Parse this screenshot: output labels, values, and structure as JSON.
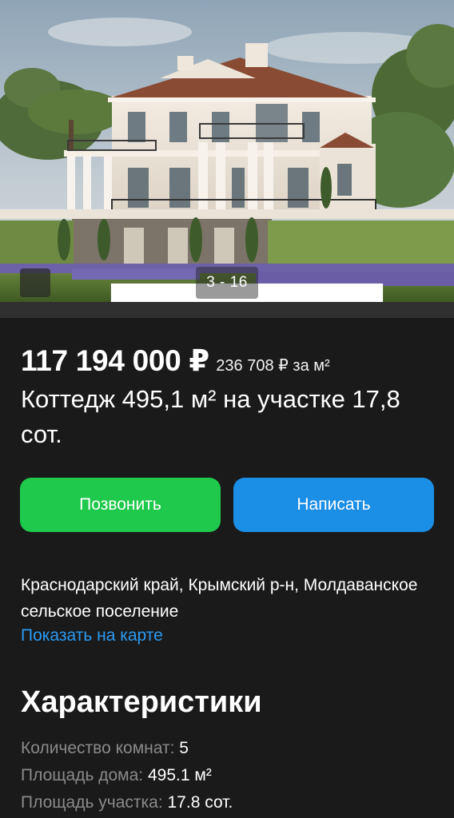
{
  "gallery": {
    "counter": "3 - 16",
    "plan_icon": "floor-plan-icon"
  },
  "listing": {
    "price": "117 194 000 ₽",
    "price_per_meter": "236 708 ₽ за м²",
    "title": "Коттедж 495,1 м² на участке 17,8 сот."
  },
  "actions": {
    "call_label": "Позвонить",
    "write_label": "Написать",
    "call_color": "#1ec94b",
    "write_color": "#1b8ee6"
  },
  "location": {
    "address": "Краснодарский край, Крымский р-н, Молдаванское сельское поселение",
    "map_link": "Показать на карте",
    "link_color": "#2b9af3"
  },
  "characteristics": {
    "heading": "Характеристики",
    "items": [
      {
        "label": "Количество комнат:",
        "value": "5"
      },
      {
        "label": "Площадь дома:",
        "value": "495.1 м²"
      },
      {
        "label": "Площадь участка:",
        "value": "17.8 сот."
      }
    ]
  }
}
